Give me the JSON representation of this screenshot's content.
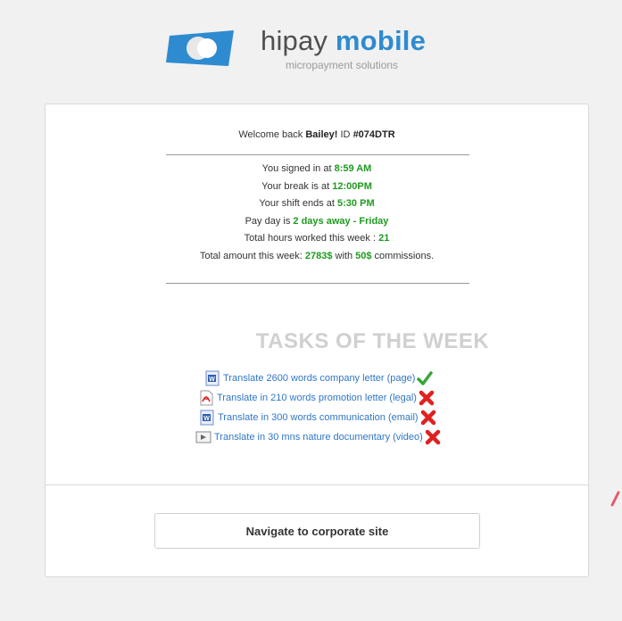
{
  "brand": {
    "name_part1": "hipay",
    "name_part2": " mobile",
    "tagline": "micropayment solutions",
    "colors": {
      "primary": "#2e8bd0",
      "text": "#505050"
    }
  },
  "welcome": {
    "prefix": "Welcome back ",
    "user": "Bailey!",
    "id_label": " ID ",
    "id": "#074DTR"
  },
  "info": {
    "signed_in_label": "You signed in at ",
    "signed_in_time": "8:59 AM",
    "break_label": "Your break is at ",
    "break_time": "12:00PM",
    "shift_end_label": "Your shift ends at ",
    "shift_end_time": "5:30 PM",
    "payday_label": "Pay day is ",
    "payday_value": "2 days away - Friday",
    "hours_label": "Total hours worked this week : ",
    "hours_value": "21",
    "amount_label": "Total amount this week: ",
    "amount_value": "2783$",
    "amount_mid": " with ",
    "commission_value": "50$",
    "commission_suffix": " commissions."
  },
  "tasks_title": "TASKS OF THE WEEK",
  "tasks": [
    {
      "label": "Translate 2600 words company letter (page)",
      "file_icon": "word-doc-icon",
      "status": "done"
    },
    {
      "label": "Translate in 210 words promotion letter (legal)",
      "file_icon": "pdf-icon",
      "status": "not-done"
    },
    {
      "label": "Translate in 300 words communication (email)",
      "file_icon": "word-doc-icon",
      "status": "not-done"
    },
    {
      "label": "Translate in 30 mns nature documentary (video)",
      "file_icon": "video-icon",
      "status": "not-done"
    }
  ],
  "navigate_button": "Navigate to corporate site",
  "status_colors": {
    "done": "#3aa53a",
    "not_done": "#e02020",
    "accent": "#1f9a1f"
  }
}
